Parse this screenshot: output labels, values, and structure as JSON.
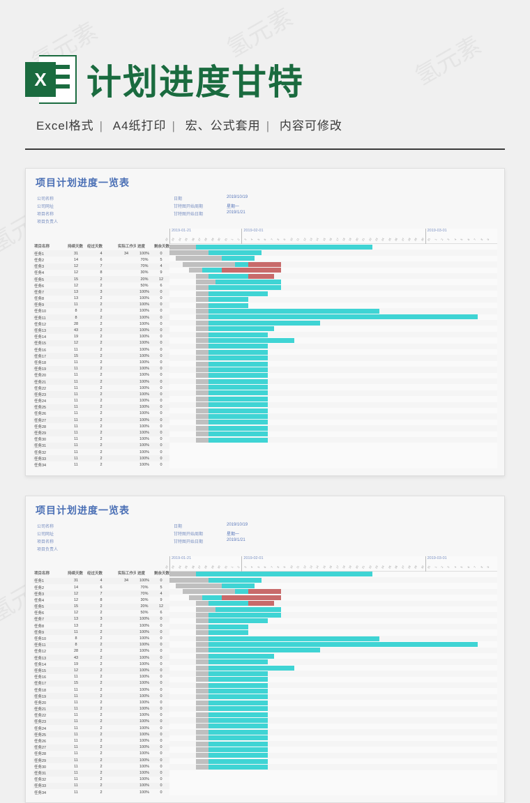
{
  "watermark_text": "氢元素",
  "hero": {
    "title": "计划进度甘特"
  },
  "subtitle": {
    "parts": [
      "Excel格式",
      "A4纸打印",
      "宏、公式套用",
      "内容可修改"
    ]
  },
  "sheet": {
    "title": "项目计划进度一览表",
    "meta_left": [
      {
        "label": "公司名称",
        "value": ""
      },
      {
        "label": "公司网址",
        "value": ""
      },
      {
        "label": "项目名称",
        "value": ""
      },
      {
        "label": "项目负责人",
        "value": ""
      }
    ],
    "meta_right": [
      {
        "label": "日期",
        "value": "2019/10/19"
      },
      {
        "label": "甘特图开始周期",
        "value": "星期一"
      },
      {
        "label": "甘特图开始日期",
        "value": "2019/1/21"
      }
    ],
    "axis_labels": [
      "2019-01-21",
      "2019-02-01",
      "2019-03-01"
    ],
    "axis_positions_pct": [
      0,
      22,
      78
    ],
    "columns": [
      "项目名称",
      "持续天数",
      "经过天数",
      "实际工作天数",
      "进度",
      "剩余天数"
    ]
  },
  "chart_data": {
    "type": "gantt",
    "timeline_days": 50,
    "tasks": [
      {
        "name": "任务1",
        "duration": 31,
        "elapsed": 4,
        "actual": 34,
        "progress": "100%",
        "remain": 0,
        "bars": [
          {
            "start": 0,
            "len": 4,
            "kind": "gray"
          },
          {
            "start": 4,
            "len": 27,
            "kind": "teal"
          }
        ]
      },
      {
        "name": "任务2",
        "duration": 14,
        "elapsed": 6,
        "actual": "",
        "progress": "70%",
        "remain": 5,
        "bars": [
          {
            "start": 0,
            "len": 6,
            "kind": "gray"
          },
          {
            "start": 6,
            "len": 8,
            "kind": "teal"
          }
        ]
      },
      {
        "name": "任务3",
        "duration": 12,
        "elapsed": 7,
        "actual": "",
        "progress": "70%",
        "remain": 4,
        "bars": [
          {
            "start": 1,
            "len": 7,
            "kind": "gray"
          },
          {
            "start": 8,
            "len": 5,
            "kind": "teal"
          }
        ]
      },
      {
        "name": "任务4",
        "duration": 12,
        "elapsed": 8,
        "actual": "",
        "progress": "30%",
        "remain": 9,
        "bars": [
          {
            "start": 2,
            "len": 8,
            "kind": "gray"
          },
          {
            "start": 10,
            "len": 2,
            "kind": "teal"
          },
          {
            "start": 12,
            "len": 5,
            "kind": "red"
          }
        ]
      },
      {
        "name": "任务5",
        "duration": 15,
        "elapsed": 2,
        "actual": "",
        "progress": "20%",
        "remain": 12,
        "bars": [
          {
            "start": 3,
            "len": 2,
            "kind": "gray"
          },
          {
            "start": 5,
            "len": 3,
            "kind": "teal"
          },
          {
            "start": 8,
            "len": 9,
            "kind": "red"
          }
        ]
      },
      {
        "name": "任务6",
        "duration": 12,
        "elapsed": 2,
        "actual": "",
        "progress": "50%",
        "remain": 6,
        "bars": [
          {
            "start": 4,
            "len": 2,
            "kind": "gray"
          },
          {
            "start": 6,
            "len": 6,
            "kind": "teal"
          },
          {
            "start": 12,
            "len": 4,
            "kind": "red"
          }
        ]
      },
      {
        "name": "任务7",
        "duration": 13,
        "elapsed": 3,
        "actual": "",
        "progress": "100%",
        "remain": 0,
        "bars": [
          {
            "start": 4,
            "len": 3,
            "kind": "gray"
          },
          {
            "start": 7,
            "len": 10,
            "kind": "teal"
          }
        ]
      },
      {
        "name": "任务8",
        "duration": 13,
        "elapsed": 2,
        "actual": "",
        "progress": "100%",
        "remain": 0,
        "bars": [
          {
            "start": 4,
            "len": 2,
            "kind": "gray"
          },
          {
            "start": 6,
            "len": 11,
            "kind": "teal"
          }
        ]
      },
      {
        "name": "任务9",
        "duration": 11,
        "elapsed": 2,
        "actual": "",
        "progress": "100%",
        "remain": 0,
        "bars": [
          {
            "start": 4,
            "len": 2,
            "kind": "gray"
          },
          {
            "start": 6,
            "len": 9,
            "kind": "teal"
          }
        ]
      },
      {
        "name": "任务10",
        "duration": 8,
        "elapsed": 2,
        "actual": "",
        "progress": "100%",
        "remain": 0,
        "bars": [
          {
            "start": 4,
            "len": 2,
            "kind": "gray"
          },
          {
            "start": 6,
            "len": 6,
            "kind": "teal"
          }
        ]
      },
      {
        "name": "任务11",
        "duration": 8,
        "elapsed": 2,
        "actual": "",
        "progress": "100%",
        "remain": 0,
        "bars": [
          {
            "start": 4,
            "len": 2,
            "kind": "gray"
          },
          {
            "start": 6,
            "len": 6,
            "kind": "teal"
          }
        ]
      },
      {
        "name": "任务12",
        "duration": 28,
        "elapsed": 2,
        "actual": "",
        "progress": "100%",
        "remain": 0,
        "bars": [
          {
            "start": 4,
            "len": 2,
            "kind": "gray"
          },
          {
            "start": 6,
            "len": 26,
            "kind": "teal"
          }
        ]
      },
      {
        "name": "任务13",
        "duration": 43,
        "elapsed": 2,
        "actual": "",
        "progress": "100%",
        "remain": 0,
        "bars": [
          {
            "start": 4,
            "len": 2,
            "kind": "gray"
          },
          {
            "start": 6,
            "len": 41,
            "kind": "teal"
          }
        ]
      },
      {
        "name": "任务14",
        "duration": 19,
        "elapsed": 2,
        "actual": "",
        "progress": "100%",
        "remain": 0,
        "bars": [
          {
            "start": 4,
            "len": 2,
            "kind": "gray"
          },
          {
            "start": 6,
            "len": 17,
            "kind": "teal"
          }
        ]
      },
      {
        "name": "任务15",
        "duration": 12,
        "elapsed": 2,
        "actual": "",
        "progress": "100%",
        "remain": 0,
        "bars": [
          {
            "start": 4,
            "len": 2,
            "kind": "gray"
          },
          {
            "start": 6,
            "len": 10,
            "kind": "teal"
          }
        ]
      },
      {
        "name": "任务16",
        "duration": 11,
        "elapsed": 2,
        "actual": "",
        "progress": "100%",
        "remain": 0,
        "bars": [
          {
            "start": 4,
            "len": 2,
            "kind": "gray"
          },
          {
            "start": 6,
            "len": 9,
            "kind": "teal"
          }
        ]
      },
      {
        "name": "任务17",
        "duration": 15,
        "elapsed": 2,
        "actual": "",
        "progress": "100%",
        "remain": 0,
        "bars": [
          {
            "start": 4,
            "len": 2,
            "kind": "gray"
          },
          {
            "start": 6,
            "len": 13,
            "kind": "teal"
          }
        ]
      },
      {
        "name": "任务18",
        "duration": 11,
        "elapsed": 2,
        "actual": "",
        "progress": "100%",
        "remain": 0,
        "bars": [
          {
            "start": 4,
            "len": 2,
            "kind": "gray"
          },
          {
            "start": 6,
            "len": 9,
            "kind": "teal"
          }
        ]
      },
      {
        "name": "任务19",
        "duration": 11,
        "elapsed": 2,
        "actual": "",
        "progress": "100%",
        "remain": 0,
        "bars": [
          {
            "start": 4,
            "len": 2,
            "kind": "gray"
          },
          {
            "start": 6,
            "len": 9,
            "kind": "teal"
          }
        ]
      },
      {
        "name": "任务20",
        "duration": 11,
        "elapsed": 2,
        "actual": "",
        "progress": "100%",
        "remain": 0,
        "bars": [
          {
            "start": 4,
            "len": 2,
            "kind": "gray"
          },
          {
            "start": 6,
            "len": 9,
            "kind": "teal"
          }
        ]
      },
      {
        "name": "任务21",
        "duration": 11,
        "elapsed": 2,
        "actual": "",
        "progress": "100%",
        "remain": 0,
        "bars": [
          {
            "start": 4,
            "len": 2,
            "kind": "gray"
          },
          {
            "start": 6,
            "len": 9,
            "kind": "teal"
          }
        ]
      },
      {
        "name": "任务22",
        "duration": 11,
        "elapsed": 2,
        "actual": "",
        "progress": "100%",
        "remain": 0,
        "bars": [
          {
            "start": 4,
            "len": 2,
            "kind": "gray"
          },
          {
            "start": 6,
            "len": 9,
            "kind": "teal"
          }
        ]
      },
      {
        "name": "任务23",
        "duration": 11,
        "elapsed": 2,
        "actual": "",
        "progress": "100%",
        "remain": 0,
        "bars": [
          {
            "start": 4,
            "len": 2,
            "kind": "gray"
          },
          {
            "start": 6,
            "len": 9,
            "kind": "teal"
          }
        ]
      },
      {
        "name": "任务24",
        "duration": 11,
        "elapsed": 2,
        "actual": "",
        "progress": "100%",
        "remain": 0,
        "bars": [
          {
            "start": 4,
            "len": 2,
            "kind": "gray"
          },
          {
            "start": 6,
            "len": 9,
            "kind": "teal"
          }
        ]
      },
      {
        "name": "任务25",
        "duration": 11,
        "elapsed": 2,
        "actual": "",
        "progress": "100%",
        "remain": 0,
        "bars": [
          {
            "start": 4,
            "len": 2,
            "kind": "gray"
          },
          {
            "start": 6,
            "len": 9,
            "kind": "teal"
          }
        ]
      },
      {
        "name": "任务26",
        "duration": 11,
        "elapsed": 2,
        "actual": "",
        "progress": "100%",
        "remain": 0,
        "bars": [
          {
            "start": 4,
            "len": 2,
            "kind": "gray"
          },
          {
            "start": 6,
            "len": 9,
            "kind": "teal"
          }
        ]
      },
      {
        "name": "任务27",
        "duration": 11,
        "elapsed": 2,
        "actual": "",
        "progress": "100%",
        "remain": 0,
        "bars": [
          {
            "start": 4,
            "len": 2,
            "kind": "gray"
          },
          {
            "start": 6,
            "len": 9,
            "kind": "teal"
          }
        ]
      },
      {
        "name": "任务28",
        "duration": 11,
        "elapsed": 2,
        "actual": "",
        "progress": "100%",
        "remain": 0,
        "bars": [
          {
            "start": 4,
            "len": 2,
            "kind": "gray"
          },
          {
            "start": 6,
            "len": 9,
            "kind": "teal"
          }
        ]
      },
      {
        "name": "任务29",
        "duration": 11,
        "elapsed": 2,
        "actual": "",
        "progress": "100%",
        "remain": 0,
        "bars": [
          {
            "start": 4,
            "len": 2,
            "kind": "gray"
          },
          {
            "start": 6,
            "len": 9,
            "kind": "teal"
          }
        ]
      },
      {
        "name": "任务30",
        "duration": 11,
        "elapsed": 2,
        "actual": "",
        "progress": "100%",
        "remain": 0,
        "bars": [
          {
            "start": 4,
            "len": 2,
            "kind": "gray"
          },
          {
            "start": 6,
            "len": 9,
            "kind": "teal"
          }
        ]
      },
      {
        "name": "任务31",
        "duration": 11,
        "elapsed": 2,
        "actual": "",
        "progress": "100%",
        "remain": 0,
        "bars": [
          {
            "start": 4,
            "len": 2,
            "kind": "gray"
          },
          {
            "start": 6,
            "len": 9,
            "kind": "teal"
          }
        ]
      },
      {
        "name": "任务32",
        "duration": 11,
        "elapsed": 2,
        "actual": "",
        "progress": "100%",
        "remain": 0,
        "bars": [
          {
            "start": 4,
            "len": 2,
            "kind": "gray"
          },
          {
            "start": 6,
            "len": 9,
            "kind": "teal"
          }
        ]
      },
      {
        "name": "任务33",
        "duration": 11,
        "elapsed": 2,
        "actual": "",
        "progress": "100%",
        "remain": 0,
        "bars": [
          {
            "start": 4,
            "len": 2,
            "kind": "gray"
          },
          {
            "start": 6,
            "len": 9,
            "kind": "teal"
          }
        ]
      },
      {
        "name": "任务34",
        "duration": 11,
        "elapsed": 2,
        "actual": "",
        "progress": "100%",
        "remain": 0,
        "bars": [
          {
            "start": 4,
            "len": 2,
            "kind": "gray"
          },
          {
            "start": 6,
            "len": 9,
            "kind": "teal"
          }
        ]
      }
    ]
  }
}
